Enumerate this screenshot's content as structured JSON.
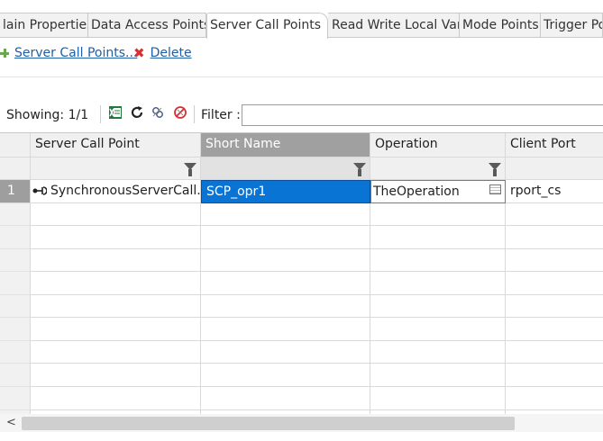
{
  "tabs": [
    {
      "label": "lain Properties"
    },
    {
      "label": "Data Access Points"
    },
    {
      "label": "Server Call Points"
    },
    {
      "label": "Read Write Local Var"
    },
    {
      "label": "Mode Points"
    },
    {
      "label": "Trigger Po"
    }
  ],
  "toolbar": {
    "add_label": "Server Call Points...",
    "delete_label": "Delete"
  },
  "table_toolbar": {
    "showing": "Showing: 1/1",
    "filter_label": "Filter :",
    "filter_value": ""
  },
  "table": {
    "columns": [
      "Server Call Point",
      "Short Name",
      "Operation",
      "Client Port"
    ],
    "rows": [
      {
        "num": "1",
        "server_call_point": "SynchronousServerCall...",
        "short_name": "SCP_opr1",
        "operation": "TheOperation",
        "client_port": "rport_cs"
      }
    ]
  },
  "colors": {
    "selection": "#0a74d4",
    "link": "#1f5fa6",
    "delete": "#d63030",
    "add": "#6aa84f"
  }
}
